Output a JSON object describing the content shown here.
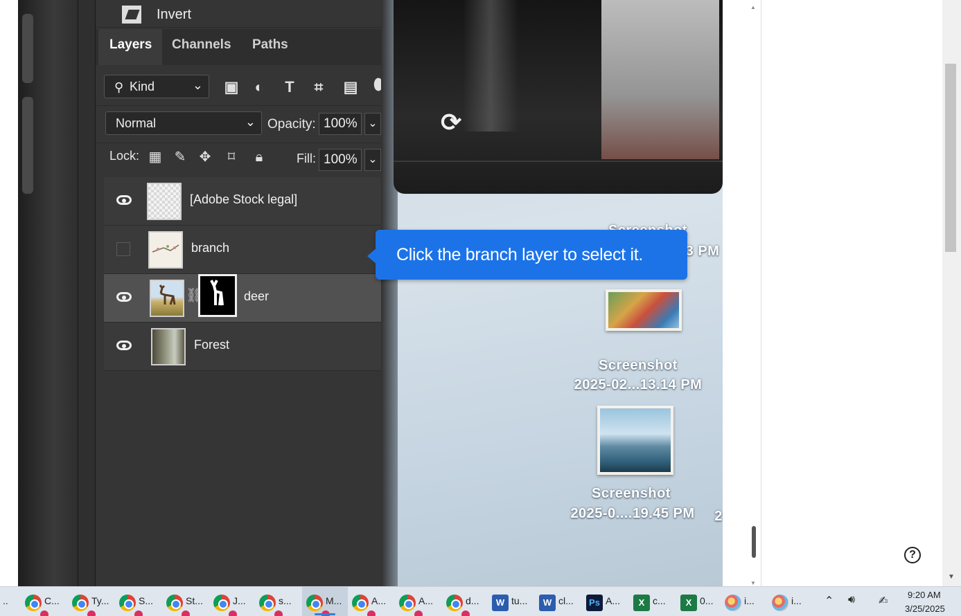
{
  "photoshop": {
    "adjustment_label": "Invert",
    "tabs": [
      {
        "label": "Layers",
        "active": true
      },
      {
        "label": "Channels",
        "active": false
      },
      {
        "label": "Paths",
        "active": false
      }
    ],
    "filter": {
      "kind_label": "Kind"
    },
    "blend_mode": "Normal",
    "opacity_label": "Opacity:",
    "opacity_value": "100%",
    "lock_label": "Lock:",
    "fill_label": "Fill:",
    "fill_value": "100%",
    "layers": [
      {
        "name": "[Adobe Stock legal]",
        "visible": true,
        "selected": false
      },
      {
        "name": "branch",
        "visible": false,
        "selected": false
      },
      {
        "name": "deer",
        "visible": true,
        "selected": true
      },
      {
        "name": "Forest",
        "visible": true,
        "selected": false
      }
    ]
  },
  "desktop": {
    "files": [
      {
        "line1": "Screenshot",
        "line2": "3 PM"
      },
      {
        "line1": "Screenshot",
        "line2": "2025-02...13.14 PM"
      },
      {
        "line1": "Screenshot",
        "line2": "2025-0....19.45 PM"
      }
    ],
    "edge_text": "2"
  },
  "tooltip": {
    "text": "Click the branch layer to select it."
  },
  "help_icon": "?",
  "taskbar": {
    "leading": "..",
    "items": [
      {
        "icon": "chrome-icon",
        "label": "C..."
      },
      {
        "icon": "chrome-icon",
        "label": "Ty..."
      },
      {
        "icon": "chrome-icon",
        "label": "S..."
      },
      {
        "icon": "chrome-icon",
        "label": "St..."
      },
      {
        "icon": "chrome-icon",
        "label": "J..."
      },
      {
        "icon": "chrome-icon",
        "label": "s..."
      },
      {
        "icon": "chrome-icon",
        "label": "M...",
        "active": true
      },
      {
        "icon": "chrome-icon",
        "label": "A..."
      },
      {
        "icon": "chrome-icon",
        "label": "A..."
      },
      {
        "icon": "chrome-icon",
        "label": "d..."
      },
      {
        "icon": "word-icon",
        "label": "tu..."
      },
      {
        "icon": "word-icon",
        "label": "cl..."
      },
      {
        "icon": "photoshop-icon",
        "label": "A..."
      },
      {
        "icon": "excel-icon",
        "label": "c..."
      },
      {
        "icon": "excel-icon",
        "label": "0..."
      },
      {
        "icon": "paint-icon",
        "label": "i..."
      },
      {
        "icon": "paint-icon",
        "label": "i..."
      }
    ],
    "clock_time": "9:20 AM",
    "clock_date": "3/25/2025"
  }
}
